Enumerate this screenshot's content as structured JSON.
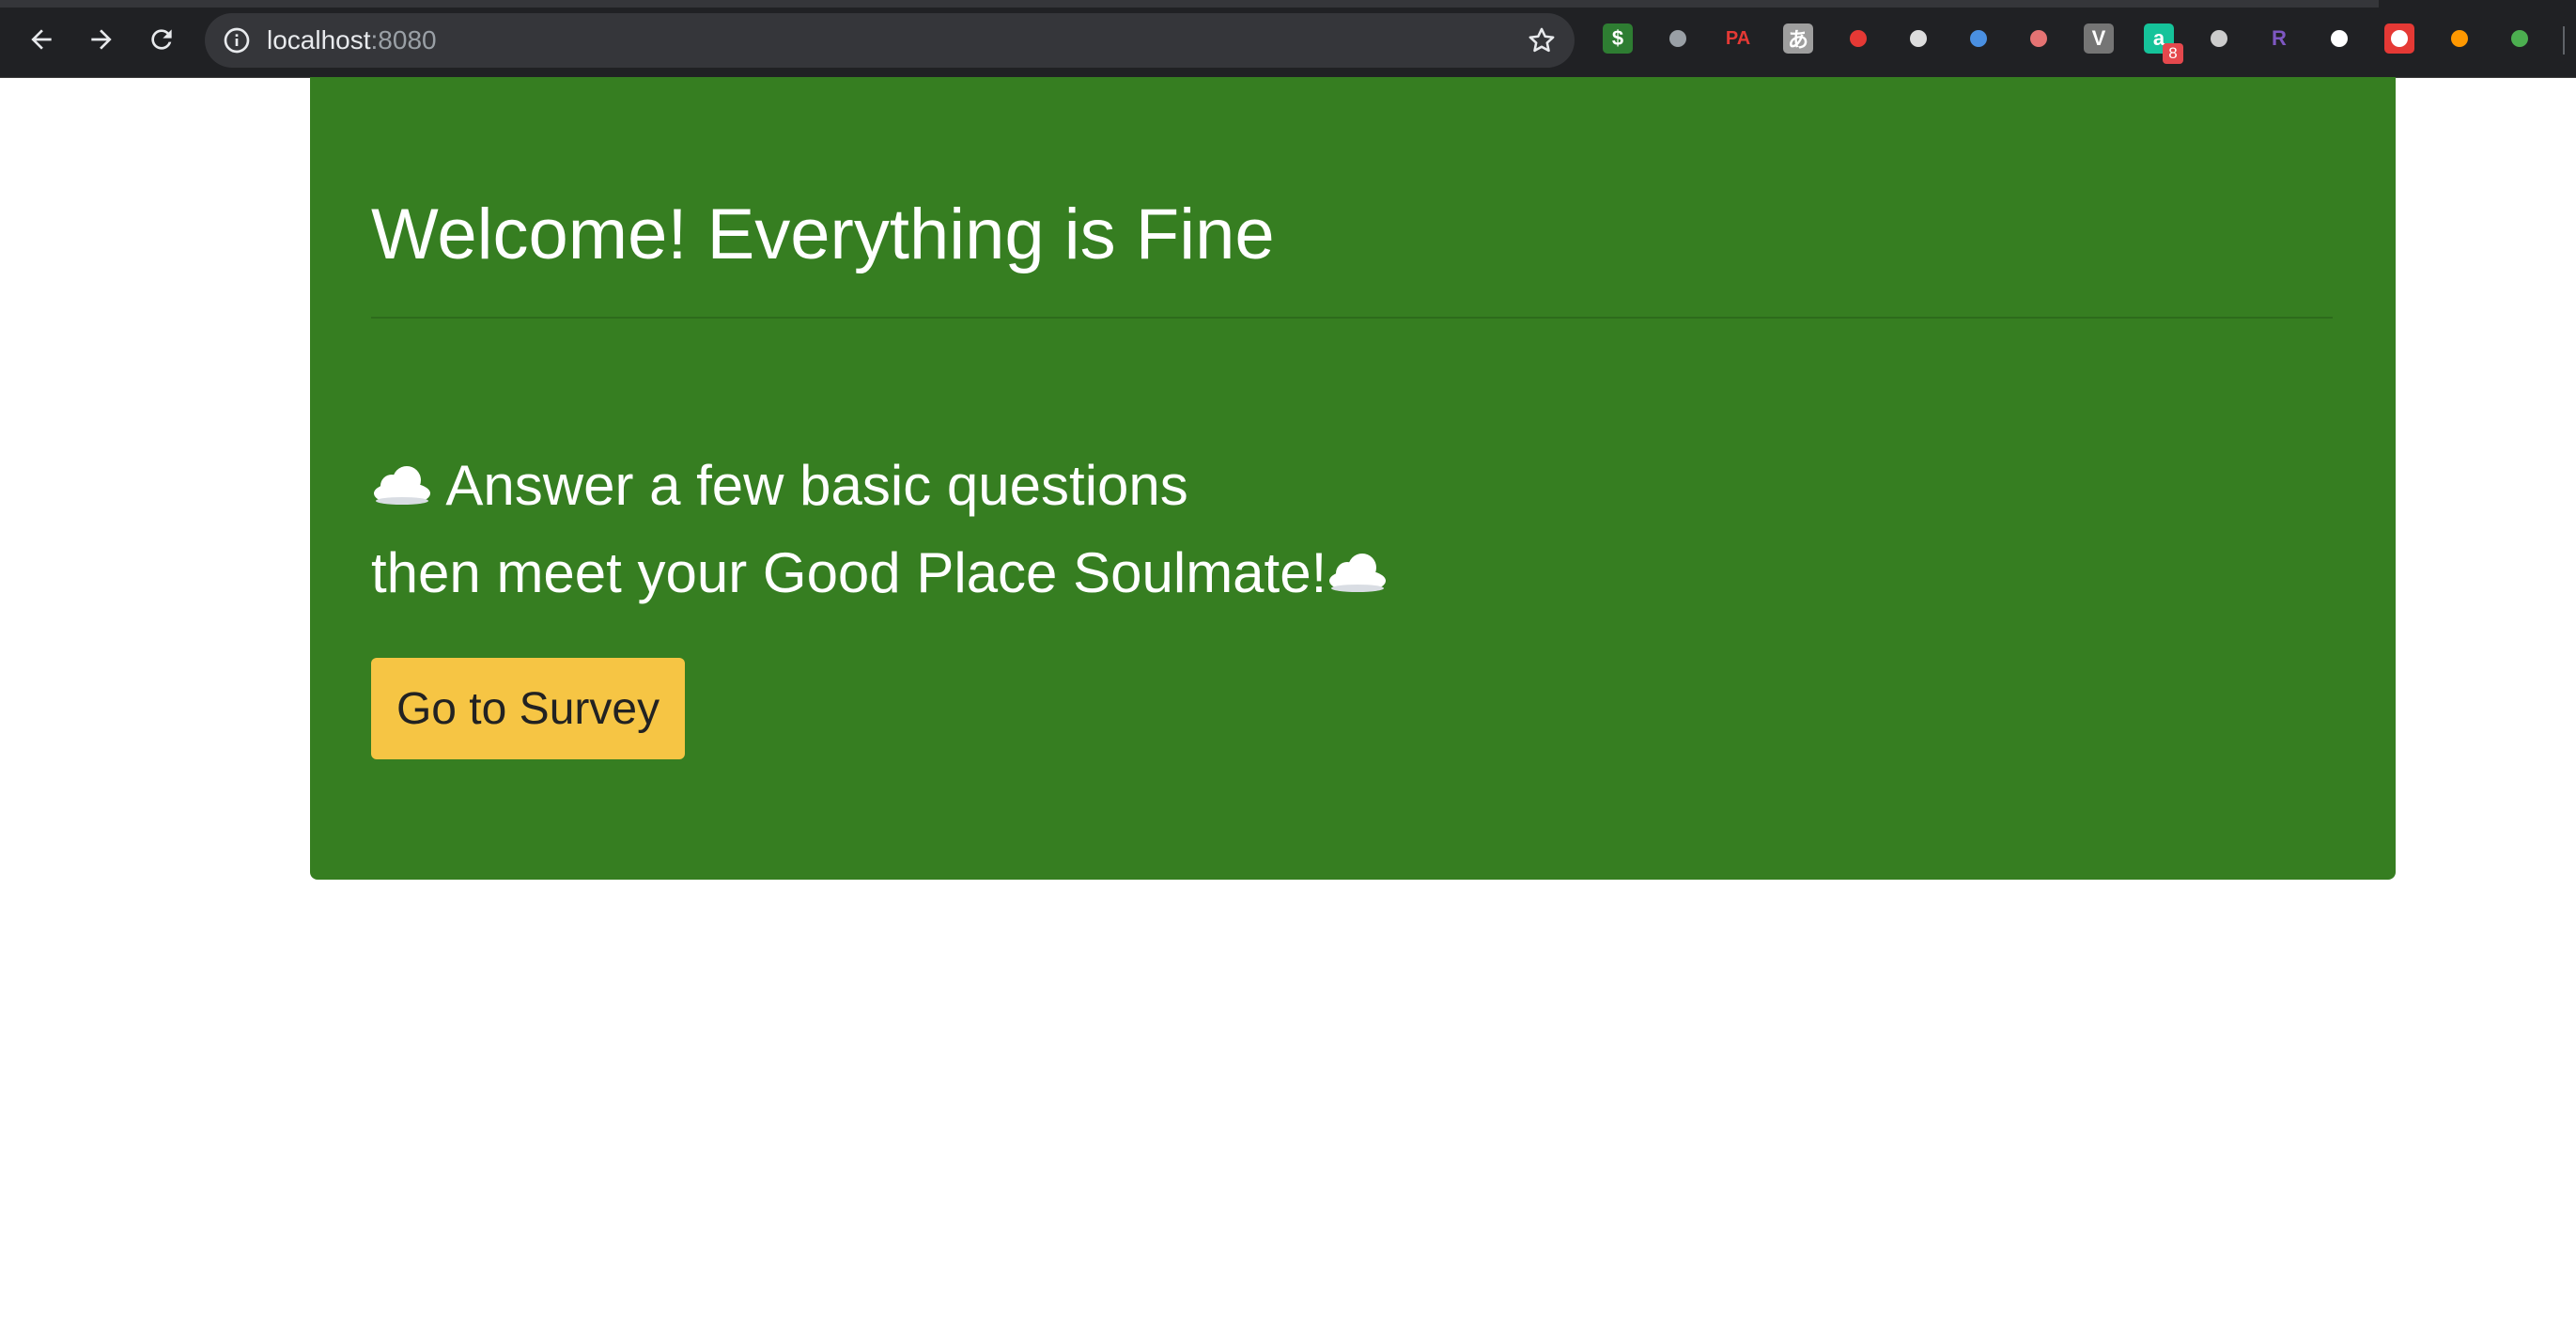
{
  "browser": {
    "url_host": "localhost",
    "url_port": ":8080",
    "extensions": [
      {
        "name": "dollar-extension-icon",
        "glyph": "$",
        "color": "#2e7d32",
        "fg": "#ffffff"
      },
      {
        "name": "eyedropper-extension-icon",
        "glyph": "",
        "color": "",
        "fg": ""
      },
      {
        "name": "pa-extension-icon",
        "glyph": "PA",
        "color": "",
        "fg": "#e53935"
      },
      {
        "name": "translate-extension-icon",
        "glyph": "あ",
        "color": "#9e9e9e",
        "fg": "#ffffff"
      },
      {
        "name": "cart-extension-icon",
        "glyph": "",
        "color": "",
        "fg": "#e53935"
      },
      {
        "name": "link-extension-icon",
        "glyph": "",
        "color": "",
        "fg": "#dddddd"
      },
      {
        "name": "ghostery-extension-icon",
        "glyph": "",
        "color": "",
        "fg": "#4a90e2"
      },
      {
        "name": "redirect-extension-icon",
        "glyph": "",
        "color": "",
        "fg": "#e57373"
      },
      {
        "name": "v-extension-icon",
        "glyph": "V",
        "color": "#757575",
        "fg": "#ffffff"
      },
      {
        "name": "grammarly-extension-icon",
        "glyph": "a",
        "color": "#15c39a",
        "fg": "#ffffff"
      },
      {
        "name": "hat-extension-icon",
        "glyph": "",
        "color": "",
        "fg": "#cccccc"
      },
      {
        "name": "r-extension-icon",
        "glyph": "R",
        "color": "",
        "fg": "#7e57c2"
      },
      {
        "name": "dots-extension-icon",
        "glyph": "",
        "color": "",
        "fg": "#ffffff"
      },
      {
        "name": "forward-extension-icon",
        "glyph": "",
        "color": "#e53935",
        "fg": "#ffffff"
      },
      {
        "name": "lamp-extension-icon",
        "glyph": "",
        "color": "",
        "fg": "#ff9800"
      },
      {
        "name": "plant-extension-icon",
        "glyph": "",
        "color": "",
        "fg": "#4caf50"
      }
    ],
    "grammarly_badge": "8"
  },
  "page": {
    "title": "Welcome! Everything is Fine",
    "lead_line1": "Answer a few basic questions",
    "lead_line2": "then meet your Good Place Soulmate!",
    "cta_label": "Go to Survey",
    "jumbotron_color": "#367e21",
    "button_color": "#f6c544"
  }
}
